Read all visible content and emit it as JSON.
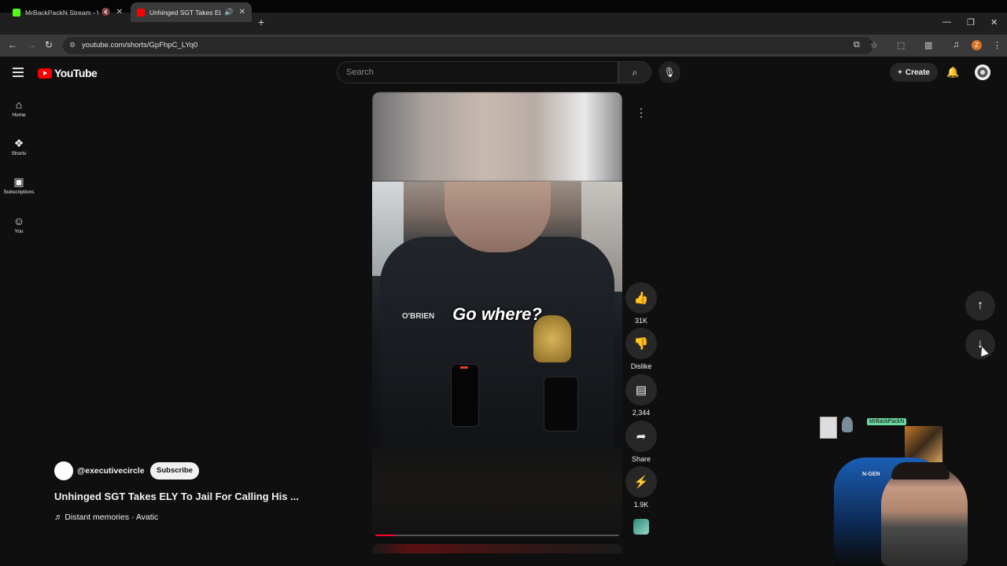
{
  "browser": {
    "tabs": [
      {
        "title": "MrBackPackN Stream - Watch",
        "favicon_color": "#53fc18",
        "active": false
      },
      {
        "title": "Unhinged SGT Takes ELY To",
        "favicon_color": "#ff0000",
        "active": true
      }
    ],
    "url": "youtube.com/shorts/GpFhpC_LYq0",
    "profile_initial": "Z"
  },
  "youtube": {
    "logo_text": "YouTube",
    "search_placeholder": "Search",
    "create_label": "Create",
    "nav": [
      {
        "label": "Home",
        "icon": "home-icon"
      },
      {
        "label": "Shorts",
        "icon": "shorts-icon"
      },
      {
        "label": "Subscriptions",
        "icon": "subscriptions-icon"
      },
      {
        "label": "You",
        "icon": "you-icon"
      }
    ]
  },
  "short": {
    "caption": "Go where?",
    "name_tag": "O'BRIEN",
    "progress_fraction": 0.085,
    "actions": {
      "like_count": "31K",
      "dislike_label": "Dislike",
      "comment_count": "2,344",
      "share_label": "Share",
      "remix_count": "1.9K"
    },
    "channel": "@executivecircle",
    "subscribe_label": "Subscribe",
    "title": "Unhinged SGT Takes ELY To Jail For Calling His ...",
    "music": "Distant memories · Avatic"
  },
  "stream_overlay": {
    "tag": "MrBackPackN",
    "chair_brand": "N-GEN"
  },
  "colors": {
    "background": "#0f0f0f",
    "brand_red": "#ff0000",
    "progress": "#ff0033",
    "button_bg": "#272727"
  }
}
